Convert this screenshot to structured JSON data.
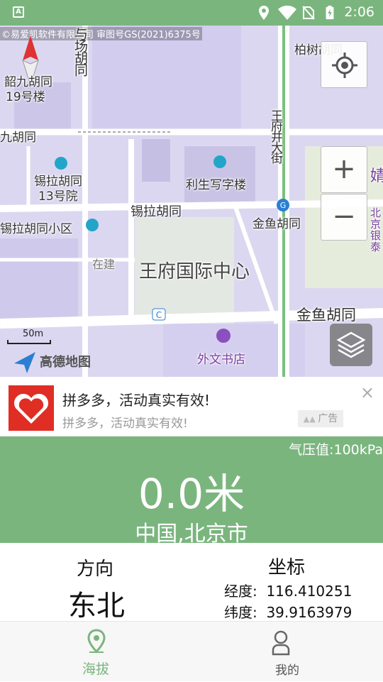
{
  "status_bar": {
    "time": "2:06",
    "app_icon": "A"
  },
  "map": {
    "copyright": "©易爱凯软件有限公司 审图号GS(2021)6375号",
    "labels": {
      "shaojiu": "韶九胡同\n19号楼",
      "shaojiu_line1": "韶九胡同",
      "shaojiu_line2": "19号楼",
      "jiuhutong": "九胡同",
      "xila13_line1": "锡拉胡同",
      "xila13_line2": "13号院",
      "xila_community": "锡拉胡同小区",
      "xila_hutong": "锡拉胡同",
      "zaijian": "在建",
      "lisheng": "利生写字楼",
      "jinyu_north": "金鱼胡同",
      "jinyu_south": "金鱼胡同",
      "wangfu_center": "王府国际中心",
      "wangfujing_street": "王府井大街",
      "baishu": "柏树胡同",
      "waiwen": "外文书店",
      "top_vertical": "与场胡同",
      "right_edge1": "婧",
      "right_edge2": "北京银泰"
    },
    "scale": "50m",
    "logo": "高德地图",
    "buttons": {
      "zoom_in": "+",
      "zoom_out": "−"
    }
  },
  "ad": {
    "title": "拼多多，活动真实有效!",
    "subtitle": "拼多多，活动真实有效!",
    "tag": "广告",
    "close": "×"
  },
  "hero": {
    "pressure": "气压值:100kPa",
    "altitude": "0.0米",
    "location": "中国,北京市"
  },
  "info": {
    "direction_label": "方向",
    "direction_value": "东北",
    "coord_label": "坐标",
    "longitude": "经度:  116.410251",
    "latitude": "纬度:  39.9163979"
  },
  "tabs": [
    {
      "label": "海拔",
      "icon": "location-pin-icon",
      "active": true
    },
    {
      "label": "我的",
      "icon": "person-icon",
      "active": false
    }
  ],
  "colors": {
    "accent": "#7ab57e",
    "map_bg": "#dcd7f0",
    "ad_brand": "#e02e24"
  }
}
